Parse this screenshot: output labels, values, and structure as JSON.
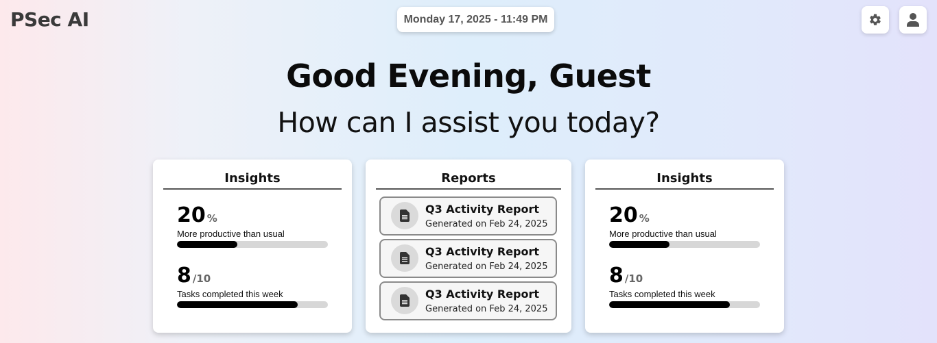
{
  "header": {
    "logo": "PSec AI",
    "datetime": "Monday 17, 2025 - 11:49 PM",
    "settings_icon": "gear-icon",
    "user_icon": "user-icon"
  },
  "hero": {
    "greeting": "Good Evening, Guest",
    "subtitle": "How can I assist you today?"
  },
  "cards": [
    {
      "title": "Insights",
      "stats": [
        {
          "value": "20",
          "unit": "%",
          "label": "More productive than usual",
          "progress": 0.4
        },
        {
          "value": "8",
          "unit": "/10",
          "label": "Tasks completed this week",
          "progress": 0.8
        }
      ]
    },
    {
      "title": "Reports",
      "items": [
        {
          "title": "Q3 Activity Report",
          "date": "Generated on Feb 24, 2025",
          "icon": "document-icon"
        },
        {
          "title": "Q3 Activity Report",
          "date": "Generated on Feb 24, 2025",
          "icon": "document-icon"
        },
        {
          "title": "Q3 Activity Report",
          "date": "Generated on Feb 24, 2025",
          "icon": "document-icon"
        }
      ]
    },
    {
      "title": "Insights",
      "stats": [
        {
          "value": "20",
          "unit": "%",
          "label": "More productive than usual",
          "progress": 0.4
        },
        {
          "value": "8",
          "unit": "/10",
          "label": "Tasks completed this week",
          "progress": 0.8
        }
      ]
    }
  ]
}
